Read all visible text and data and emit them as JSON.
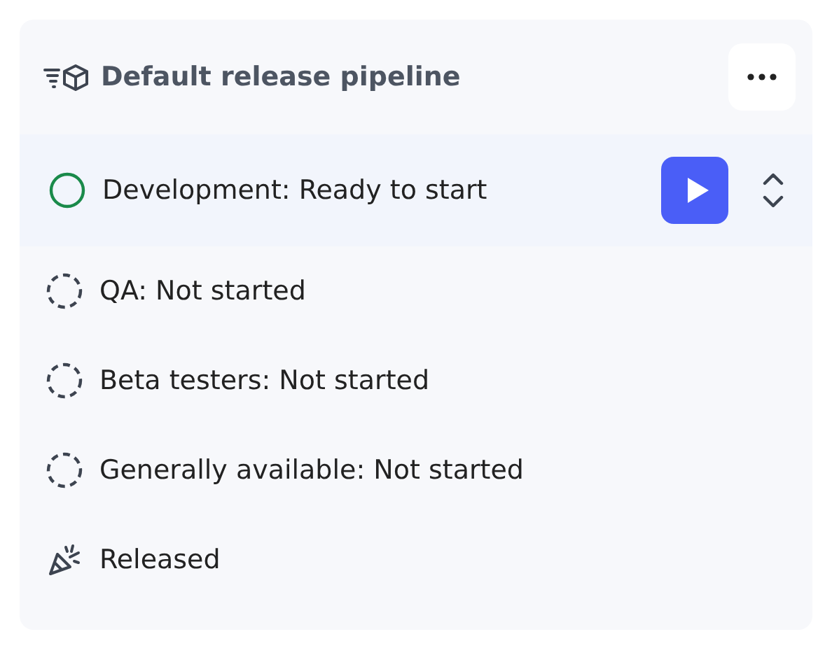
{
  "pipeline": {
    "title": "Default release pipeline"
  },
  "stages": [
    {
      "label": "Development: Ready to start",
      "kind": "ready",
      "selected": true
    },
    {
      "label": "QA: Not started",
      "kind": "pending",
      "selected": false
    },
    {
      "label": "Beta testers: Not started",
      "kind": "pending",
      "selected": false
    },
    {
      "label": "Generally available: Not started",
      "kind": "pending",
      "selected": false
    },
    {
      "label": "Released",
      "kind": "released",
      "selected": false
    }
  ]
}
